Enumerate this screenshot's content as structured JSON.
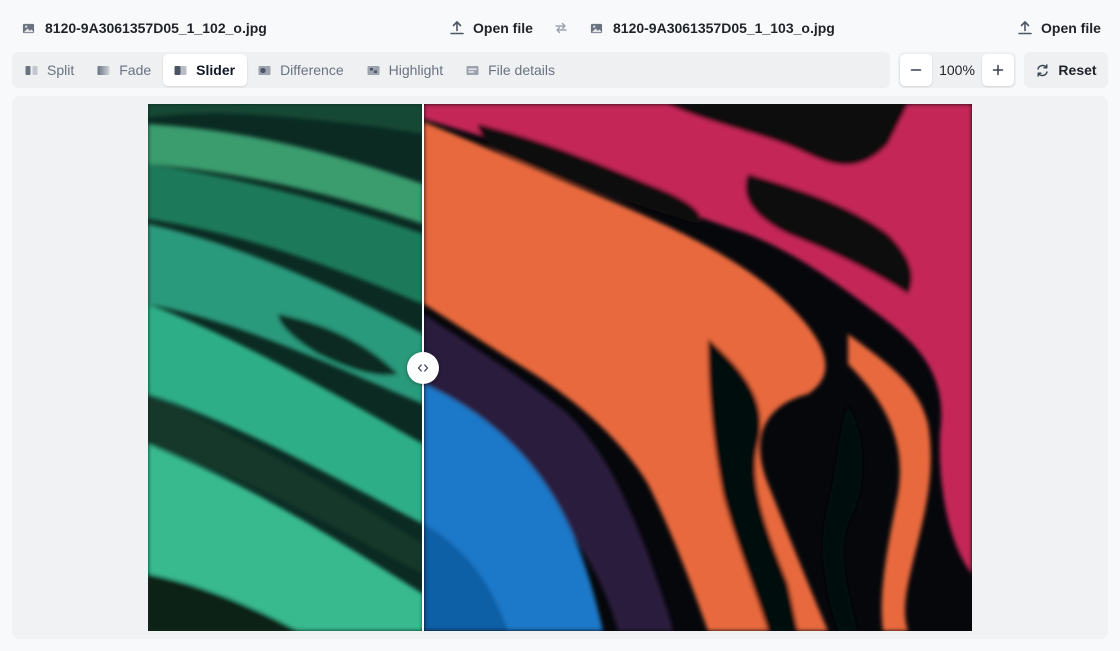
{
  "files": {
    "left_name": "8120-9A3061357D05_1_102_o.jpg",
    "right_name": "8120-9A3061357D05_1_103_o.jpg",
    "open_label": "Open file"
  },
  "modes": [
    {
      "label": "Split",
      "icon": "split-icon",
      "active": false
    },
    {
      "label": "Fade",
      "icon": "fade-icon",
      "active": false
    },
    {
      "label": "Slider",
      "icon": "slider-icon",
      "active": true
    },
    {
      "label": "Difference",
      "icon": "difference-icon",
      "active": false
    },
    {
      "label": "Highlight",
      "icon": "highlight-icon",
      "active": false
    },
    {
      "label": "File details",
      "icon": "file-details-icon",
      "active": false
    }
  ],
  "zoom": {
    "level": "100%"
  },
  "reset_label": "Reset",
  "slider": {
    "position": 0.334
  },
  "colors": {
    "accent_left": "#2fae86",
    "accent_right_pink": "#c42558",
    "accent_right_orange": "#e8693e",
    "accent_right_blue": "#1b78c8"
  }
}
